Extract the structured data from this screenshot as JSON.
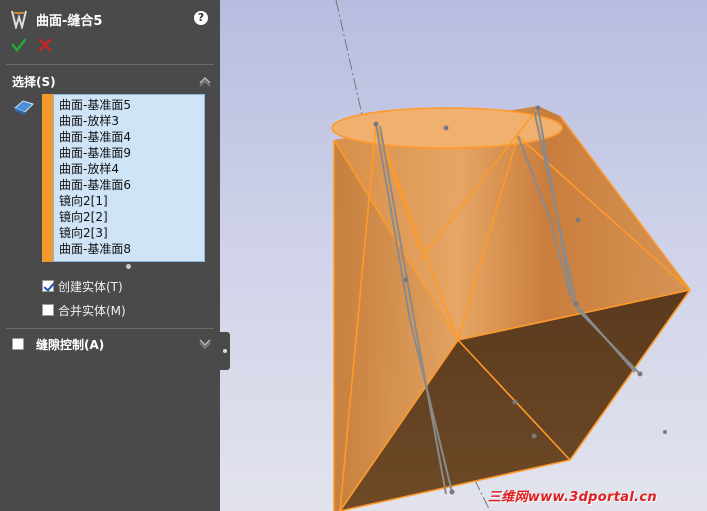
{
  "panel": {
    "title": "曲面-缝合5",
    "help_label": "?",
    "colors": {
      "panel_bg": "#4a4a4a",
      "list_bg": "#cfe4f7",
      "accent": "#f39a2b",
      "ok": "#22aa33",
      "cancel": "#cc2222"
    }
  },
  "selection": {
    "label": "选择(S)",
    "items": [
      "曲面-基准面5",
      "曲面-放样3",
      "曲面-基准面4",
      "曲面-基准面9",
      "曲面-放样4",
      "曲面-基准面6",
      "镜向2[1]",
      "镜向2[2]",
      "镜向2[3]",
      "曲面-基准面8"
    ],
    "create_solid": {
      "label": "创建实体(T)",
      "checked": true
    },
    "merge_solid": {
      "label": "合并实体(M)",
      "checked": false
    }
  },
  "gap_control": {
    "label": "缝隙控制(A)",
    "checked": false
  },
  "watermark": "三维网www.3dportal.cn"
}
